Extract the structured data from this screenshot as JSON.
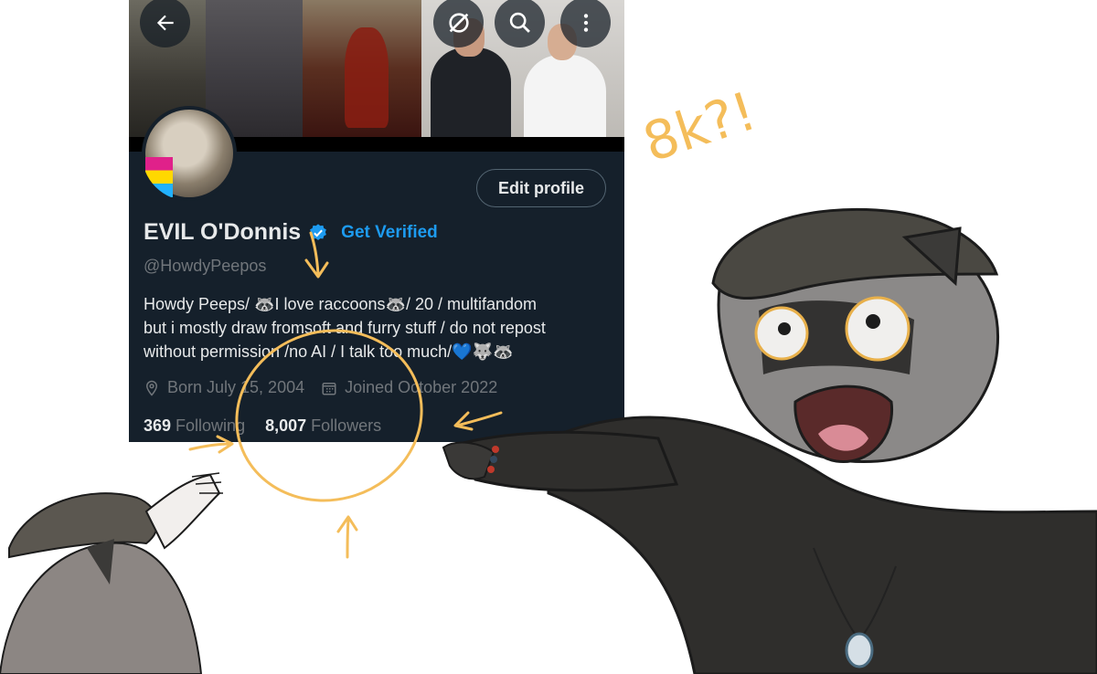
{
  "header": {
    "back_icon": "arrow-left-icon",
    "grok_icon": "slashed-circle-icon",
    "search_icon": "search-icon",
    "more_icon": "more-vertical-icon"
  },
  "profile": {
    "edit_label": "Edit profile",
    "name": "EVIL O'Donnis",
    "get_verified": "Get Verified",
    "handle": "@HowdyPeepos",
    "bio_line1": "Howdy Peeps/ 🦝I love raccoons🦝/ 20 / multifandom",
    "bio_line2": "but i mostly draw fromsoft and furry stuff / do not repost",
    "bio_line3": "without permission /no AI / I talk too much/💙🐺🦝",
    "born": "Born July 15, 2004",
    "joined": "Joined October 2022",
    "following_count": "369",
    "following_label": "Following",
    "followers_count": "8,007",
    "followers_label": "Followers"
  },
  "annotation": {
    "text": "8k?!"
  },
  "colors": {
    "card_bg": "#15202b",
    "accent": "#1d9bf0",
    "muted": "#71767b",
    "doodle": "#f4bd5a"
  }
}
